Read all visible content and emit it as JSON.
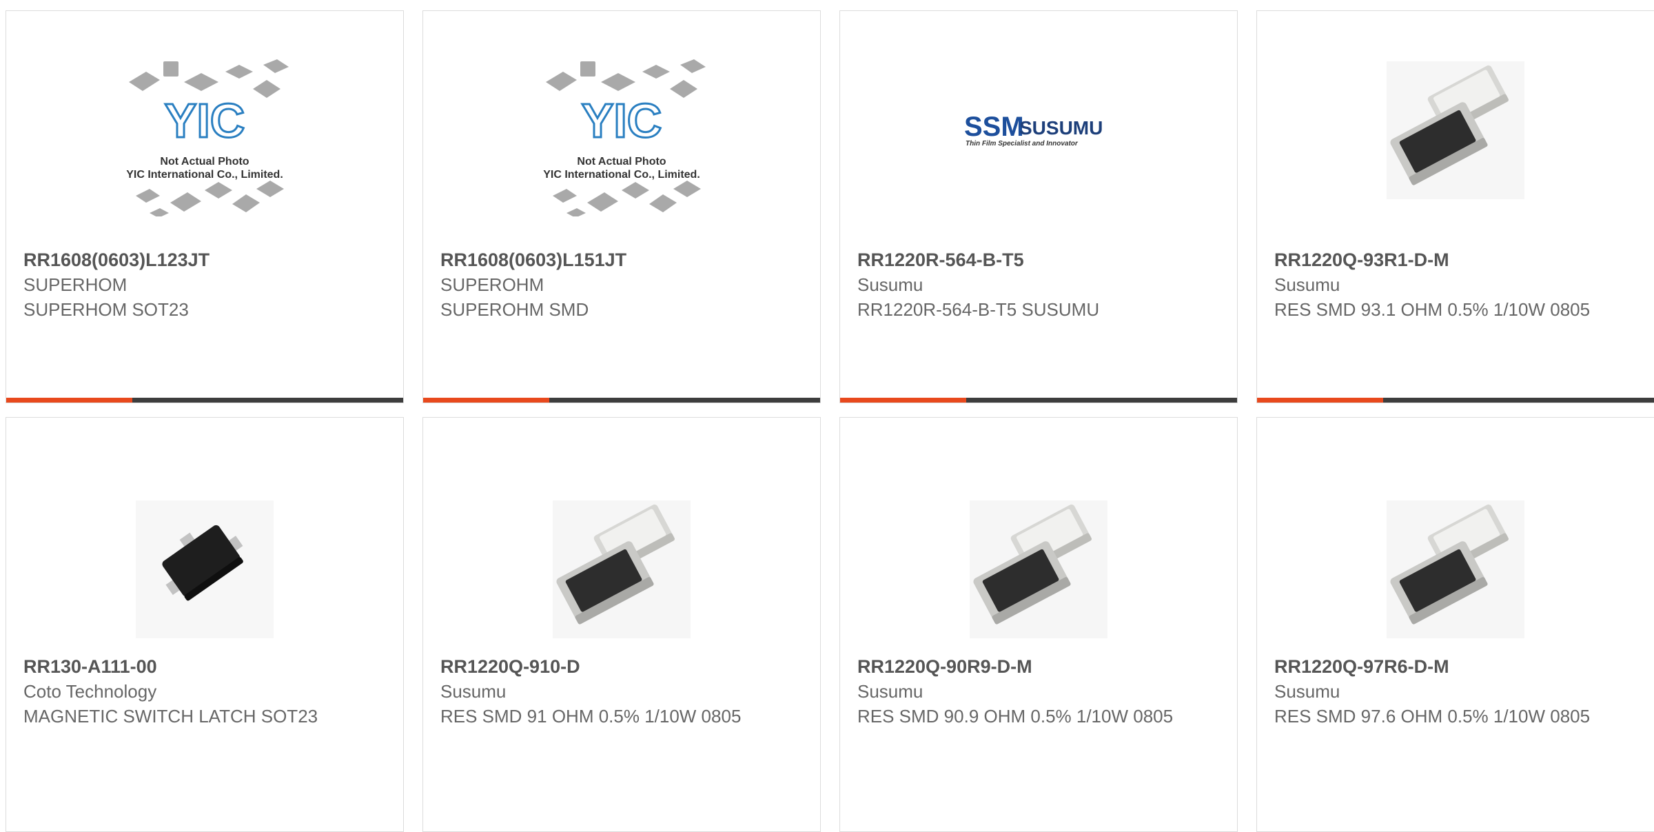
{
  "products": [
    {
      "part": "RR1608(0603)L123JT",
      "manufacturer": "SUPERHOM",
      "description": "SUPERHOM SOT23",
      "image": "yic-placeholder",
      "image_note_line1": "Not Actual Photo",
      "image_note_line2": "YIC International Co., Limited.",
      "image_logo": "YIC"
    },
    {
      "part": "RR1608(0603)L151JT",
      "manufacturer": "SUPEROHM",
      "description": "SUPEROHM SMD",
      "image": "yic-placeholder",
      "image_note_line1": "Not Actual Photo",
      "image_note_line2": "YIC International Co., Limited.",
      "image_logo": "YIC"
    },
    {
      "part": "RR1220R-564-B-T5",
      "manufacturer": "Susumu",
      "description": "RR1220R-564-B-T5 SUSUMU",
      "image": "susumu-logo",
      "image_logo": "SSM",
      "image_logo_text": "SUSUMU",
      "image_tagline": "Thin Film Specialist and Innovator"
    },
    {
      "part": "RR1220Q-93R1-D-M",
      "manufacturer": "Susumu",
      "description": "RES SMD 93.1 OHM 0.5% 1/10W 0805",
      "image": "smd-resistor-photo"
    },
    {
      "part": "RR130-A111-00",
      "manufacturer": "Coto Technology",
      "description": "MAGNETIC SWITCH LATCH SOT23",
      "image": "sot23-package-photo"
    },
    {
      "part": "RR1220Q-910-D",
      "manufacturer": "Susumu",
      "description": "RES SMD 91 OHM 0.5% 1/10W 0805",
      "image": "smd-resistor-photo"
    },
    {
      "part": "RR1220Q-90R9-D-M",
      "manufacturer": "Susumu",
      "description": "RES SMD 90.9 OHM 0.5% 1/10W 0805",
      "image": "smd-resistor-photo"
    },
    {
      "part": "RR1220Q-97R6-D-M",
      "manufacturer": "Susumu",
      "description": "RES SMD 97.6 OHM 0.5% 1/10W 0805",
      "image": "smd-resistor-photo"
    }
  ],
  "colors": {
    "accent": "#e8491d",
    "bar": "#3d3d3d",
    "border": "#dcdcdc",
    "text": "#666666",
    "yic_blue": "#2a7fc1",
    "susumu_blue": "#1d4f9c"
  }
}
